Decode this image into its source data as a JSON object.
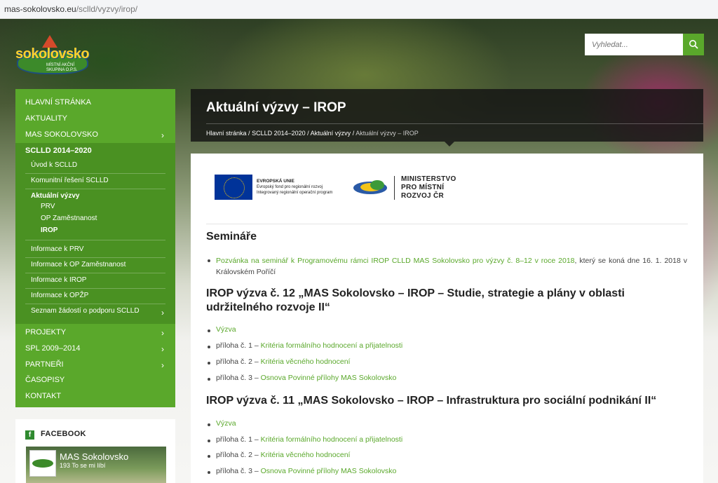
{
  "url": {
    "domain": "mas-sokolovsko.eu",
    "path": "/sclld/vyzvy/irop/"
  },
  "logo": {
    "text": "sokolovsko",
    "sub": "MÍSTNÍ AKČNÍ SKUPINA O.P.S."
  },
  "search": {
    "placeholder": "Vyhledat..."
  },
  "nav": [
    {
      "label": "HLAVNÍ STRÁNKA"
    },
    {
      "label": "AKTUALITY"
    },
    {
      "label": "MAS SOKOLOVSKO"
    },
    {
      "label": "SCLLD 2014–2020"
    }
  ],
  "subnav": [
    {
      "label": "Úvod k SCLLD"
    },
    {
      "label": "Komunitní řešení SCLLD"
    },
    {
      "label": "Aktuální výzvy"
    },
    {
      "label": "PRV"
    },
    {
      "label": "OP Zaměstnanost"
    },
    {
      "label": "IROP"
    },
    {
      "label": "Informace k PRV"
    },
    {
      "label": "Informace k OP Zaměstnanost"
    },
    {
      "label": "Informace k IROP"
    },
    {
      "label": "Informace k OPŽP"
    },
    {
      "label": "Seznam žádostí o podporu SCLLD"
    }
  ],
  "nav_bottom": [
    {
      "label": "PROJEKTY"
    },
    {
      "label": "SPL 2009–2014"
    },
    {
      "label": "PARTNEŘI"
    },
    {
      "label": "ČASOPISY"
    },
    {
      "label": "KONTAKT"
    }
  ],
  "facebook": {
    "title": "FACEBOOK",
    "page_name": "MAS Sokolovsko",
    "likes": "193 To se mi líbí"
  },
  "header": {
    "title": "Aktuální výzvy – IROP",
    "crumbs": [
      "Hlavní stránka",
      "SCLLD 2014–2020",
      "Aktuální výzvy"
    ],
    "current": "Aktuální výzvy – IROP"
  },
  "eu_logo": {
    "line1": "EVROPSKÁ UNIE",
    "line2": "Evropský fond pro regionální rozvoj",
    "line3": "Integrovaný regionální operační program"
  },
  "mmr_logo": {
    "line1": "MINISTERSTVO",
    "line2": "PRO MÍSTNÍ",
    "line3": "ROZVOJ ČR"
  },
  "seminare": {
    "heading": "Semináře",
    "link": "Pozvánka na seminář k Programovému rámci IROP CLLD MAS Sokolovsko pro výzvy č. 8–12 v roce 2018",
    "rest": ", který se koná dne 16. 1. 2018 v Královském Poříčí"
  },
  "vyzva12": {
    "heading": "IROP výzva č. 12 „MAS Sokolovsko – IROP – Studie, strategie a plány v oblasti udržitelného rozvoje II“",
    "vyzva": "Výzva",
    "p1_pre": "příloha č. 1 – ",
    "p1_link": "Kritéria formálního hodnocení a přijatelnosti",
    "p2_pre": "příloha č. 2 – ",
    "p2_link": "Kritéria věcného hodnocení",
    "p3_pre": "příloha č. 3 – ",
    "p3_link": "Osnova Povinné přílohy MAS Sokolovsko"
  },
  "vyzva11": {
    "heading": "IROP výzva č. 11 „MAS Sokolovsko – IROP – Infrastruktura pro sociální podnikání II“",
    "vyzva": "Výzva",
    "p1_pre": "příloha č. 1 – ",
    "p1_link": "Kritéria formálního hodnocení a přijatelnosti",
    "p2_pre": "příloha č. 2 – ",
    "p2_link": "Kritéria věcného hodnocení",
    "p3_pre": "příloha č. 3 – ",
    "p3_link": "Osnova Povinné přílohy MAS Sokolovsko"
  },
  "colors": {
    "accent": "#5aa82b",
    "accent_dark": "#4a9122",
    "header_bg": "#141414"
  }
}
